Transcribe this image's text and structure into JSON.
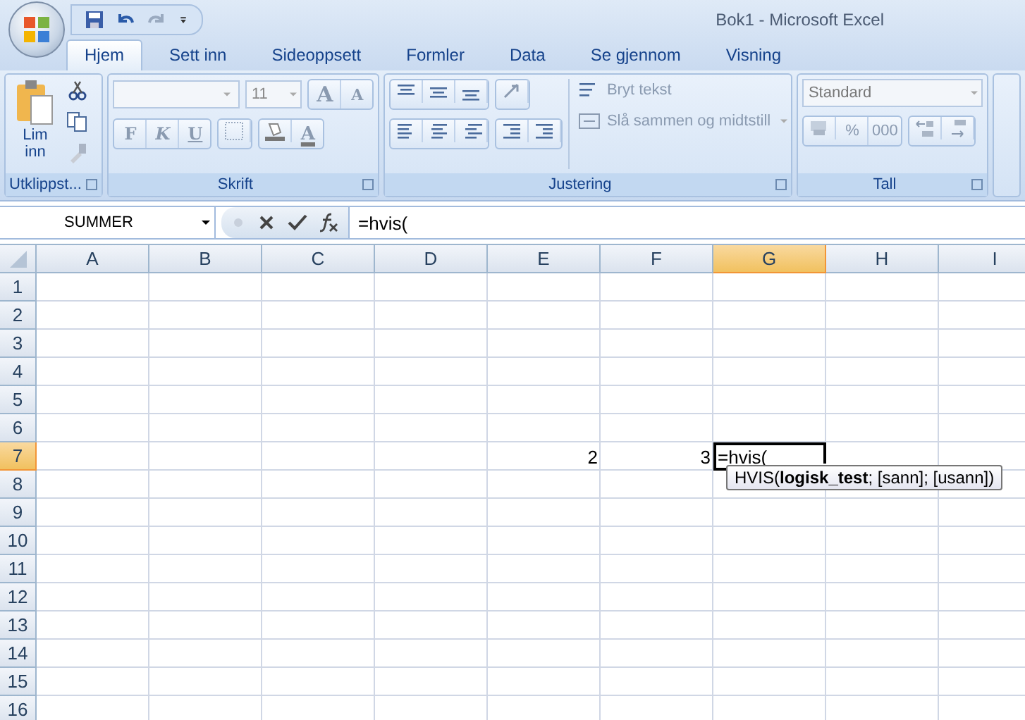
{
  "window": {
    "title": "Bok1 - Microsoft Excel"
  },
  "tabs": [
    {
      "label": "Hjem",
      "selected": true
    },
    {
      "label": "Sett inn",
      "selected": false
    },
    {
      "label": "Sideoppsett",
      "selected": false
    },
    {
      "label": "Formler",
      "selected": false
    },
    {
      "label": "Data",
      "selected": false
    },
    {
      "label": "Se gjennom",
      "selected": false
    },
    {
      "label": "Visning",
      "selected": false
    }
  ],
  "ribbon": {
    "clipboard": {
      "label": "Utklippst...",
      "paste": "Lim inn"
    },
    "font": {
      "label": "Skrift",
      "size": "11",
      "bold": "F",
      "italic": "K",
      "underline": "U",
      "grow": "A",
      "shrink": "A",
      "color_letter": "A"
    },
    "alignment": {
      "label": "Justering",
      "wrap": "Bryt tekst",
      "merge": "Slå sammen og midtstill"
    },
    "number": {
      "label": "Tall",
      "format": "Standard",
      "percent": "%",
      "thousands": "000"
    }
  },
  "formula_bar": {
    "name_box": "SUMMER",
    "formula": "=hvis("
  },
  "grid": {
    "columns": [
      {
        "label": "A",
        "selected": false
      },
      {
        "label": "B",
        "selected": false
      },
      {
        "label": "C",
        "selected": false
      },
      {
        "label": "D",
        "selected": false
      },
      {
        "label": "E",
        "selected": false
      },
      {
        "label": "F",
        "selected": false
      },
      {
        "label": "G",
        "selected": true
      },
      {
        "label": "H",
        "selected": false
      },
      {
        "label": "I",
        "selected": false
      }
    ],
    "rows": [
      {
        "label": "1",
        "selected": false
      },
      {
        "label": "2",
        "selected": false
      },
      {
        "label": "3",
        "selected": false
      },
      {
        "label": "4",
        "selected": false
      },
      {
        "label": "5",
        "selected": false
      },
      {
        "label": "6",
        "selected": false
      },
      {
        "label": "7",
        "selected": true,
        "cells": [
          null,
          null,
          null,
          null,
          {
            "kind": "number",
            "text": "2"
          },
          {
            "kind": "number",
            "text": "3"
          },
          {
            "kind": "editing",
            "text": "=hvis("
          }
        ]
      },
      {
        "label": "8",
        "selected": false
      },
      {
        "label": "9",
        "selected": false
      },
      {
        "label": "10",
        "selected": false
      },
      {
        "label": "11",
        "selected": false
      },
      {
        "label": "12",
        "selected": false
      },
      {
        "label": "13",
        "selected": false
      },
      {
        "label": "14",
        "selected": false
      },
      {
        "label": "15",
        "selected": false
      },
      {
        "label": "16",
        "selected": false
      }
    ],
    "tooltip": "HVIS(**logisk_test**; [sann]; [usann])"
  }
}
